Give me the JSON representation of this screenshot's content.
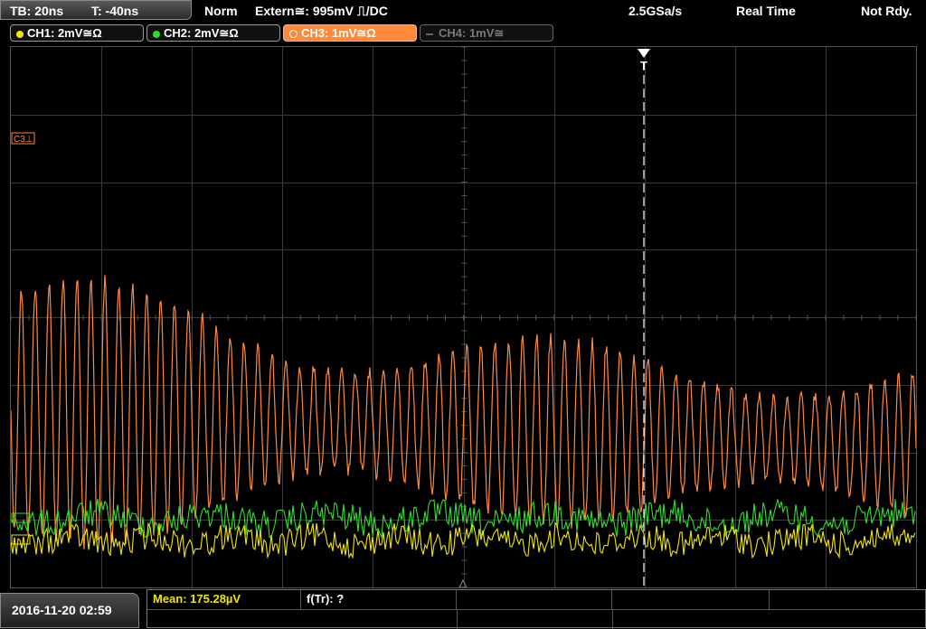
{
  "header": {
    "timebase": "TB: 20ns",
    "trigger_time": "T: -40ns",
    "mode": "Norm",
    "trigger_source": "Extern≅: 995mV ⎍/DC",
    "sample_rate": "2.5GSa/s",
    "acq_mode": "Real Time",
    "status": "Not Rdy."
  },
  "channels": [
    {
      "label": "CH1: 2mV≅Ω",
      "color": "#f2e600",
      "active": false
    },
    {
      "label": "CH2: 2mV≅Ω",
      "color": "#2ee02e",
      "active": false
    },
    {
      "label": "CH3: 1mV≅Ω",
      "color": "#ff8a3d",
      "active": true
    },
    {
      "label": "CH4: 1mV≅",
      "color": "#7a7a7a",
      "active": false
    }
  ],
  "markers": {
    "c3_ref": "C3⊥",
    "trigger_marker": "T"
  },
  "colors": {
    "ch1": "#f2e600",
    "ch2": "#2ee02e",
    "ch3": "#ff8a3d",
    "grid": "#3a3a3a",
    "trigger_line": "#ffffff"
  },
  "footer": {
    "datetime": "2016-11-20 02:59",
    "mean_label": "Mean: 175.28µV",
    "ftr_label": "f(Tr): ?"
  }
}
